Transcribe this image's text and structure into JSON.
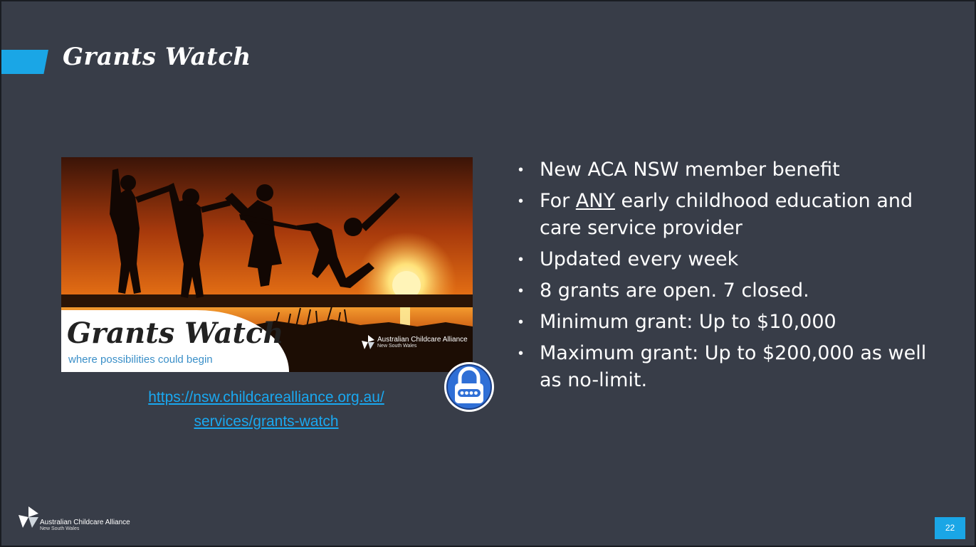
{
  "slide": {
    "title": "Grants Watch",
    "colors": {
      "background": "#383d48",
      "accent": "#1aa6e6",
      "link": "#1aa8f0",
      "text": "#ffffff"
    },
    "hero_image": {
      "brand_text": "Grants Watch",
      "tagline": "where possibilities could begin",
      "org_name": "Australian Childcare Alliance",
      "org_sub": "New South Wales"
    },
    "lock_icon": "padlock-icon",
    "link": {
      "line1": "https://nsw.childcarealliance.org.au/",
      "line2": "services/grants-watch"
    },
    "bullets": [
      {
        "text": "New ACA NSW member benefit"
      },
      {
        "prefix": "For ",
        "underlined": "ANY",
        "suffix": " early childhood education and care service provider"
      },
      {
        "text": "Updated every week"
      },
      {
        "text": "8 grants are open. 7 closed."
      },
      {
        "text": "Minimum grant: Up to $10,000"
      },
      {
        "text": "Maximum grant: Up to $200,000 as well as no-limit."
      }
    ],
    "footer": {
      "logo_icon": "aca-logo-icon",
      "org_name": "Australian Childcare Alliance",
      "org_sub": "New South Wales"
    },
    "page_number": "22"
  }
}
